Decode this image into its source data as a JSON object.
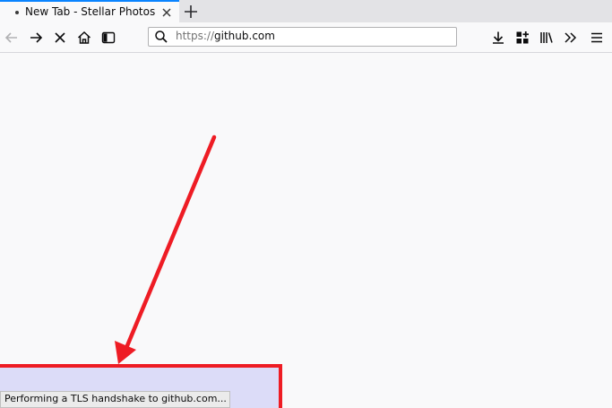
{
  "tab": {
    "title": "New Tab - Stellar Photos",
    "close_icon": "close-icon",
    "new_tab_icon": "plus-icon"
  },
  "navbar": {
    "back_icon": "back-arrow-icon",
    "forward_icon": "forward-arrow-icon",
    "stop_icon": "stop-icon",
    "home_icon": "home-icon",
    "sidebar_icon": "sidebar-icon",
    "url_scheme": "https://",
    "url_host": "github.com",
    "download_icon": "download-icon",
    "addons_icon": "extensions-grid-icon",
    "library_icon": "library-icon",
    "overflow_icon": "chevron-double-right-icon",
    "menu_icon": "hamburger-menu-icon"
  },
  "status": {
    "text": "Performing a TLS handshake to github.com..."
  },
  "annotation": {
    "color": "#ee1c24",
    "fill": "#dcdcf8"
  },
  "colors": {
    "accent": "#0a84ff",
    "background": "#f9f9fa"
  }
}
